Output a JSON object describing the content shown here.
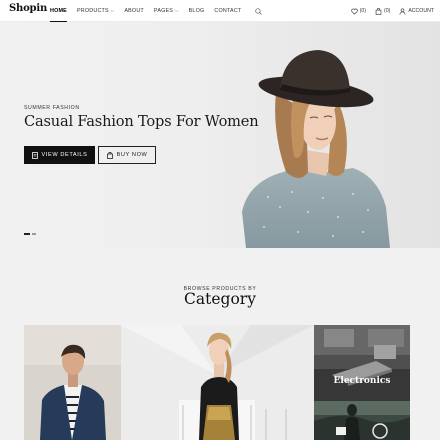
{
  "header": {
    "logo": "Shopin",
    "nav": [
      {
        "label": "HOME",
        "has_dropdown": false,
        "active": true
      },
      {
        "label": "PRODUCTS",
        "has_dropdown": true,
        "active": false
      },
      {
        "label": "ABOUT",
        "has_dropdown": false,
        "active": false
      },
      {
        "label": "PAGES",
        "has_dropdown": true,
        "active": false
      },
      {
        "label": "BLOG",
        "has_dropdown": false,
        "active": false
      },
      {
        "label": "CONTACT",
        "has_dropdown": false,
        "active": false
      }
    ],
    "wishlist_count": "(0)",
    "cart_count": "(0)",
    "account_label": "ACCOUNT",
    "icons": {
      "search": "search-icon",
      "wishlist": "heart-icon",
      "cart": "bag-icon",
      "account": "user-icon"
    }
  },
  "hero": {
    "eyebrow": "SUMMER FASHION",
    "title": "Casual Fashion Tops For Women",
    "primary_button": "VIEW DETAILS",
    "secondary_button": "BUY NOW",
    "slides": 2,
    "active_slide": 1
  },
  "categories": {
    "eyebrow": "BROWSE PRODUCTS BY",
    "title": "Category",
    "tiles": [
      {
        "label": ""
      },
      {
        "label": ""
      },
      {
        "label": "Electronics"
      },
      {
        "label": ""
      }
    ]
  },
  "colors": {
    "accent": "#111111",
    "background": "#f1f1f1",
    "header_bg": "#ffffff"
  }
}
